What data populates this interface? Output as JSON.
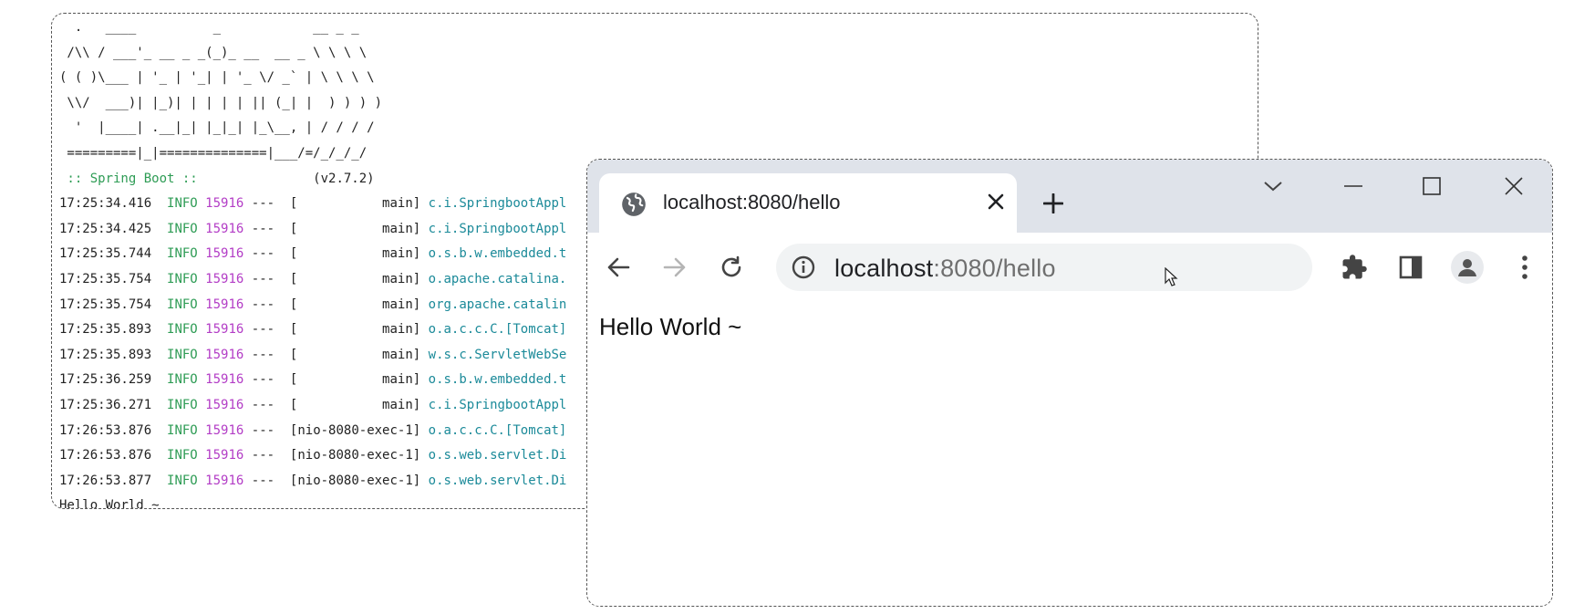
{
  "console": {
    "banner": [
      "  .   ____          _            __ _ _",
      " /\\\\ / ___'_ __ _ _(_)_ __  __ _ \\ \\ \\ \\",
      "( ( )\\___ | '_ | '_| | '_ \\/ _` | \\ \\ \\ \\",
      " \\\\/  ___)| |_)| | | | | || (_| |  ) ) ) )",
      "  '  |____| .__|_| |_|_| |_\\__, | / / / /",
      " =========|_|==============|___/=/_/_/_/"
    ],
    "spring_label": " :: Spring Boot :: ",
    "version": "              (v2.7.2)",
    "log_lines": [
      {
        "time": "17:25:34.416",
        "level": "INFO",
        "pid": "15916",
        "thread": "---  [           main] ",
        "logger": "c.i.SpringbootAppl"
      },
      {
        "time": "17:25:34.425",
        "level": "INFO",
        "pid": "15916",
        "thread": "---  [           main] ",
        "logger": "c.i.SpringbootAppl"
      },
      {
        "time": "17:25:35.744",
        "level": "INFO",
        "pid": "15916",
        "thread": "---  [           main] ",
        "logger": "o.s.b.w.embedded.t"
      },
      {
        "time": "17:25:35.754",
        "level": "INFO",
        "pid": "15916",
        "thread": "---  [           main] ",
        "logger": "o.apache.catalina."
      },
      {
        "time": "17:25:35.754",
        "level": "INFO",
        "pid": "15916",
        "thread": "---  [           main] ",
        "logger": "org.apache.catalin"
      },
      {
        "time": "17:25:35.893",
        "level": "INFO",
        "pid": "15916",
        "thread": "---  [           main] ",
        "logger": "o.a.c.c.C.[Tomcat]"
      },
      {
        "time": "17:25:35.893",
        "level": "INFO",
        "pid": "15916",
        "thread": "---  [           main] ",
        "logger": "w.s.c.ServletWebSe"
      },
      {
        "time": "17:25:36.259",
        "level": "INFO",
        "pid": "15916",
        "thread": "---  [           main] ",
        "logger": "o.s.b.w.embedded.t"
      },
      {
        "time": "17:25:36.271",
        "level": "INFO",
        "pid": "15916",
        "thread": "---  [           main] ",
        "logger": "c.i.SpringbootAppl"
      },
      {
        "time": "17:26:53.876",
        "level": "INFO",
        "pid": "15916",
        "thread": "---  [nio-8080-exec-1] ",
        "logger": "o.a.c.c.C.[Tomcat]"
      },
      {
        "time": "17:26:53.876",
        "level": "INFO",
        "pid": "15916",
        "thread": "---  [nio-8080-exec-1] ",
        "logger": "o.s.web.servlet.Di"
      },
      {
        "time": "17:26:53.877",
        "level": "INFO",
        "pid": "15916",
        "thread": "---  [nio-8080-exec-1] ",
        "logger": "o.s.web.servlet.Di"
      }
    ],
    "final_output": "Hello World ~"
  },
  "browser": {
    "tab_title": "localhost:8080/hello",
    "url_host": "localhost",
    "url_rest": ":8080/hello",
    "page_text": "Hello World ~"
  },
  "colors": {
    "info": "#2e9c55",
    "pid": "#b33dc6",
    "logger": "#1b8a99",
    "titlebar": "#dfe3ea"
  },
  "icons": [
    "globe-icon",
    "close-icon",
    "plus-icon",
    "chevron-down-icon",
    "minimize-icon",
    "maximize-icon",
    "window-close-icon",
    "back-icon",
    "forward-icon",
    "reload-icon",
    "info-icon",
    "extensions-icon",
    "side-panel-icon",
    "profile-icon",
    "more-icon",
    "mouse-cursor-icon"
  ]
}
